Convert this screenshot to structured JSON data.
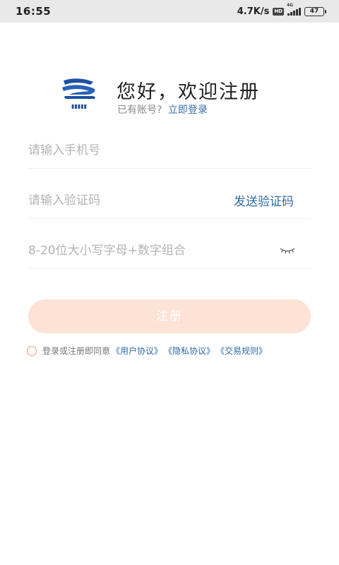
{
  "status_bar": {
    "time": "16:55",
    "net_speed": "4.7K/s",
    "hd_badge": "HD",
    "network_type": "4G",
    "battery": "47"
  },
  "header": {
    "title": "您好，欢迎注册",
    "have_account": "已有账号?",
    "login_link": "立即登录"
  },
  "form": {
    "phone_placeholder": "请输入手机号",
    "phone_value": "",
    "code_placeholder": "请输入验证码",
    "code_value": "",
    "send_code_label": "发送验证码",
    "password_placeholder": "8-20位大小写字母+数字组合",
    "password_value": "",
    "register_label": "注册"
  },
  "agreement": {
    "prefix": "登录或注册即同意",
    "links": [
      "《用户协议》",
      "《隐私协议》",
      "《交易规则》"
    ]
  },
  "colors": {
    "accent_blue": "#2f6aa6",
    "button_disabled": "#fde2d6",
    "status_bar_bg": "#e9e9e9"
  }
}
